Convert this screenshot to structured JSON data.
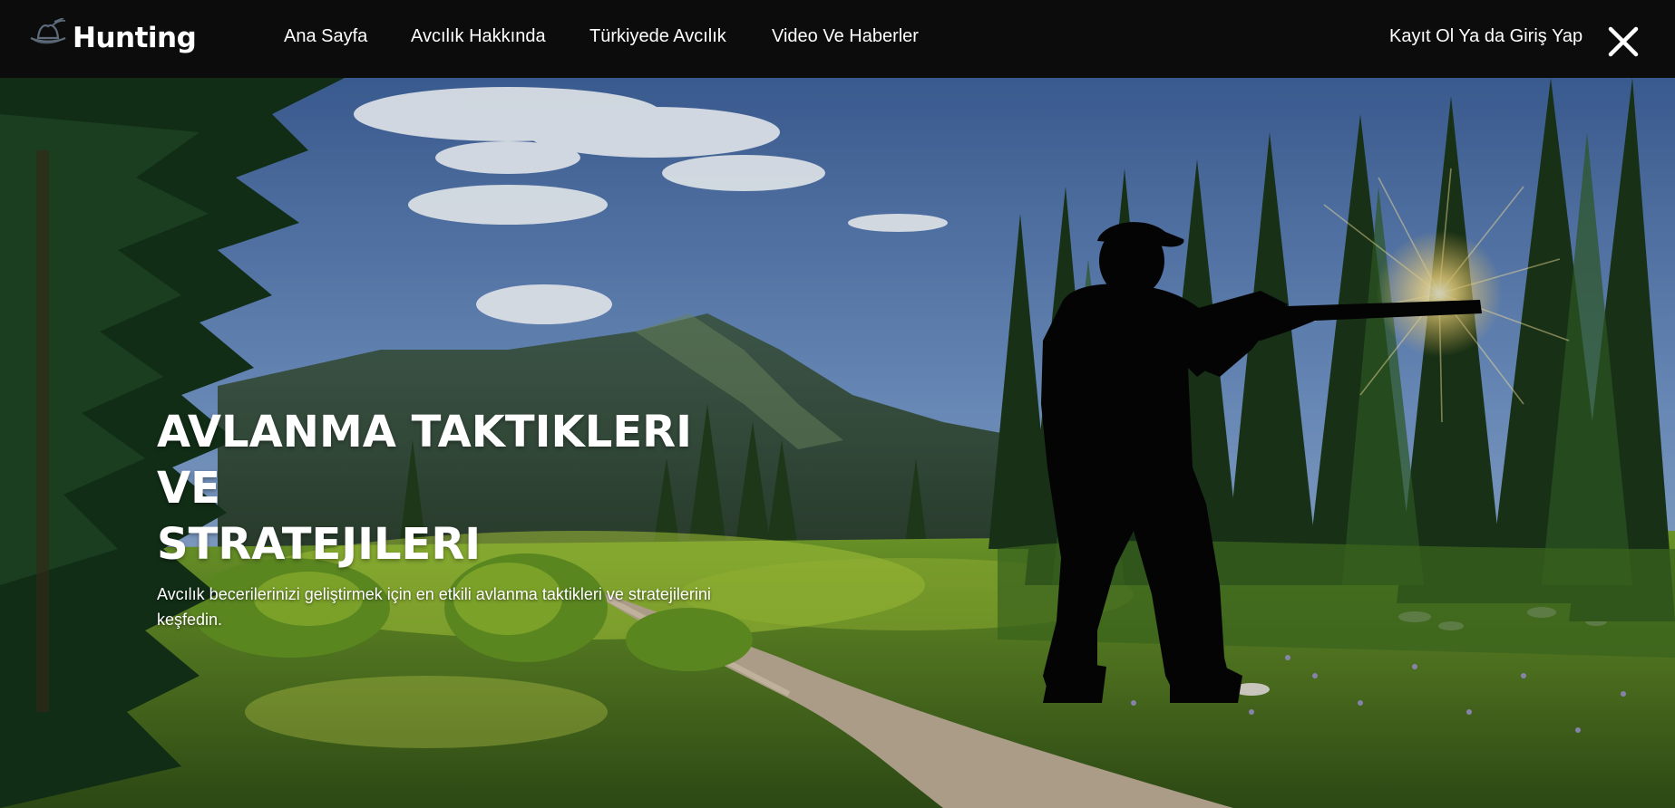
{
  "brand": {
    "name": "Hunting",
    "icon": "hunter-hat-icon"
  },
  "nav": {
    "links": [
      {
        "label": "Ana Sayfa"
      },
      {
        "label": "Avcılık Hakkında"
      },
      {
        "label": "Türkiyede Avcılık"
      },
      {
        "label": "Video Ve Haberler"
      }
    ],
    "auth_label": "Kayıt Ol Ya da Giriş Yap",
    "close_icon": "close-icon"
  },
  "hero": {
    "title_lines": [
      "AVLANMA TAKTIKLERI",
      "VE",
      "STRATEJILERI"
    ],
    "subtitle": "Avcılık becerilerinizi geliştirmek için en etkili avlanma taktikleri ve stratejilerini keşfedin.",
    "illustration": "hunter-silhouette-in-forest"
  },
  "colors": {
    "navbar_bg": "#0c0c0c",
    "text": "#ffffff"
  }
}
